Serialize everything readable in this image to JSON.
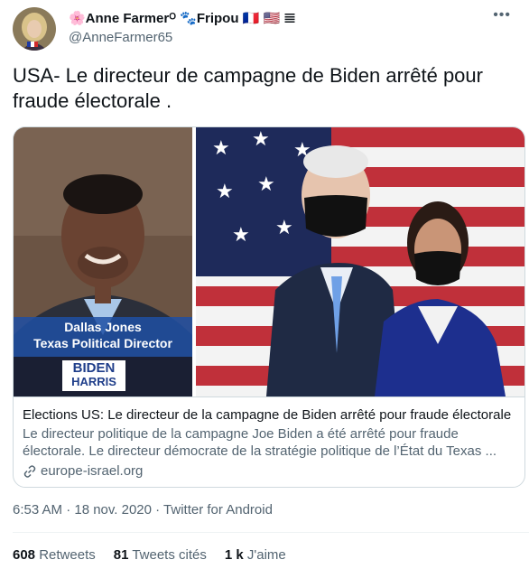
{
  "user": {
    "display_name": "🌸Anne Farmerᴼ 🐾Fripou 🇫🇷 🇺🇸 𝌆",
    "handle": "@AnneFarmer65"
  },
  "tweet": {
    "text": "USA- Le directeur de campagne de Biden arrêté pour fraude électorale ."
  },
  "card": {
    "image_caption_name": "Dallas Jones",
    "image_caption_role": "Texas Political Director",
    "logo_line1": "BIDEN",
    "logo_line2": "HARRIS",
    "title": "Elections US: Le directeur de la campagne de Biden arrêté pour fraude électorale",
    "description": "Le directeur politique de la campagne Joe Biden a été arrêté pour fraude électorale. Le directeur démocrate de la stratégie politique de l’État du Texas ...",
    "domain": "europe-israel.org"
  },
  "meta": {
    "timestamp": "6:53 AM · 18 nov. 2020 · Twitter for Android"
  },
  "stats": {
    "retweets_count": "608",
    "retweets_label": "Retweets",
    "quotes_count": "81",
    "quotes_label": "Tweets cités",
    "likes_count": "1 k",
    "likes_label": "J'aime"
  },
  "colors": {
    "text_primary": "#0f1419",
    "text_secondary": "#536471",
    "border": "#cfd9de",
    "caption_bar": "#1f4fa3",
    "flag_red": "#c0303a",
    "flag_blue": "#1e2a5a"
  }
}
